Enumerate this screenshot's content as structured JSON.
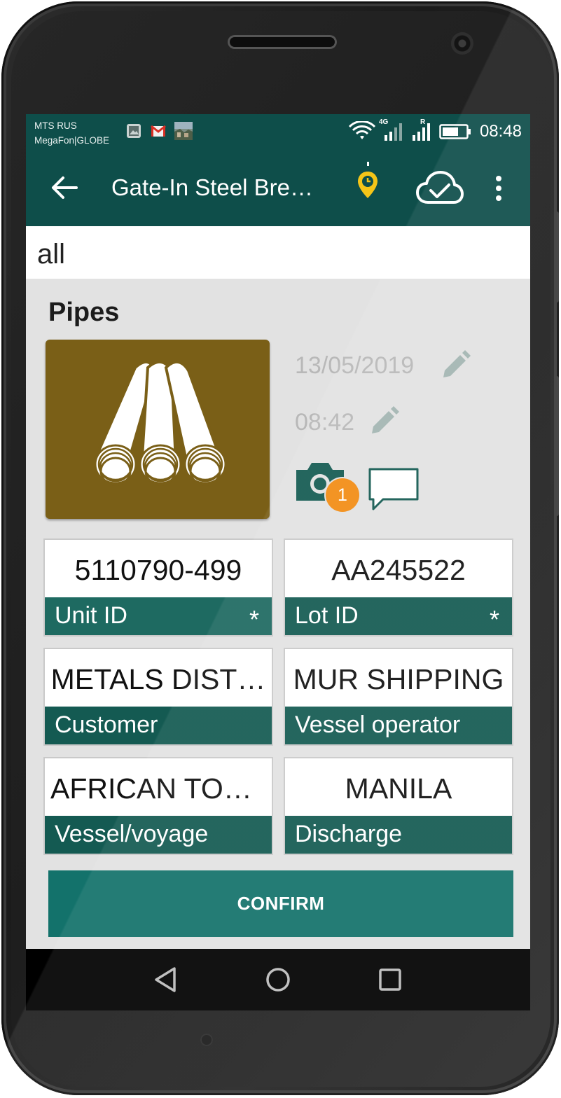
{
  "status_bar": {
    "carrier_line1": "MTS RUS",
    "carrier_line2": "MegaFon|GLOBE",
    "notification_icons": [
      "gallery-icon",
      "gmail-icon",
      "photo-thumbnail-icon"
    ],
    "network_1": "4G",
    "network_2": "R",
    "time": "08:48"
  },
  "app_bar": {
    "title": "Gate-In Steel Bre…",
    "icons": [
      "back-arrow-icon",
      "location-clock-icon",
      "cloud-sync-icon",
      "more-vert-icon"
    ]
  },
  "filter": {
    "value": "all"
  },
  "item": {
    "title": "Pipes",
    "date": "13/05/2019",
    "time": "08:42",
    "photo_count": "1"
  },
  "fields": {
    "unit_id": {
      "value": "5110790-499",
      "label": "Unit ID",
      "required_mark": "*"
    },
    "lot_id": {
      "value": "AA245522",
      "label": "Lot ID",
      "required_mark": "*"
    },
    "customer": {
      "value": "METALS DIST…",
      "label": "Customer"
    },
    "vessel_operator": {
      "value": "MUR SHIPPING",
      "label": "Vessel operator"
    },
    "vessel_voyage": {
      "value": "AFRICAN TOU…",
      "label": "Vessel/voyage"
    },
    "discharge": {
      "value": "MANILA",
      "label": "Discharge"
    }
  },
  "actions": {
    "confirm_label": "CONFIRM"
  },
  "colors": {
    "app_bar": "#0e4e4a",
    "field_label": "#145a52",
    "confirm": "#13726b",
    "badge": "#f28c13",
    "product_tile": "#7a5f17",
    "pin": "#f5c518"
  }
}
